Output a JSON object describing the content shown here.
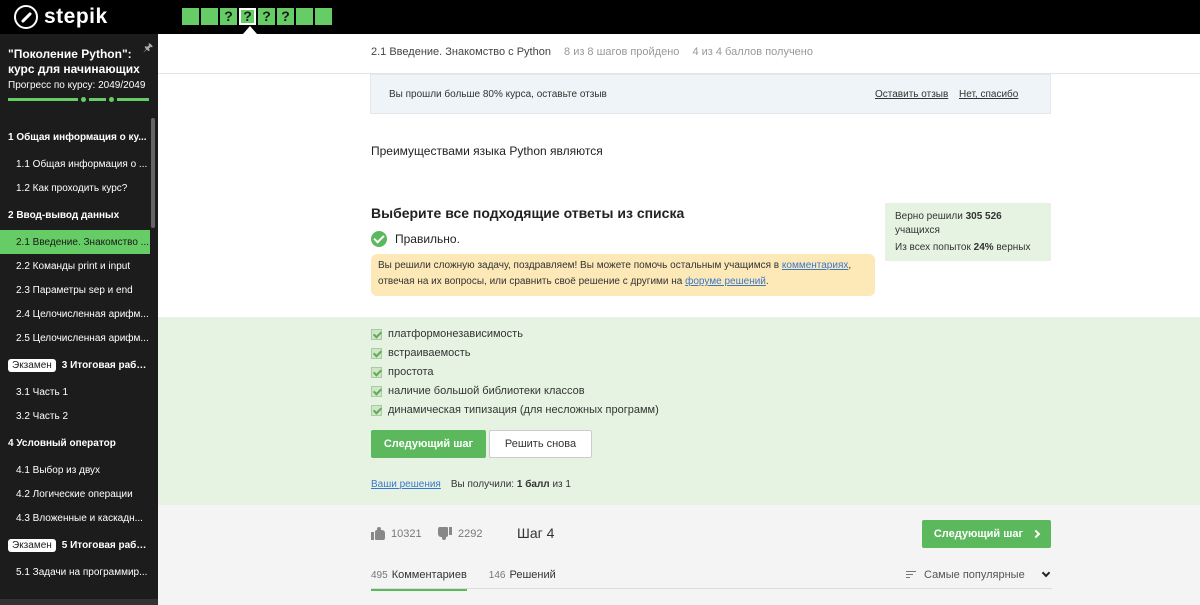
{
  "header": {
    "logo_text": "stepik",
    "step_buttons": [
      "",
      "",
      "?",
      "?",
      "?",
      "?",
      "",
      ""
    ],
    "active_step_index": 3
  },
  "sidebar": {
    "course_title": "\"Поколение Python\": курс для начинающих",
    "progress_label": "Прогресс по курсу:  2049/2049",
    "progress_fraction": 1.0,
    "toc": [
      {
        "kind": "module",
        "label": "1  Общая информация о ку..."
      },
      {
        "kind": "lesson",
        "label": "1.1  Общая информация о ..."
      },
      {
        "kind": "lesson",
        "label": "1.2  Как проходить курс?"
      },
      {
        "kind": "module",
        "label": "2  Ввод-вывод данных"
      },
      {
        "kind": "lesson",
        "label": "2.1  Введение. Знакомство ...",
        "active": true
      },
      {
        "kind": "lesson",
        "label": "2.2  Команды print и input"
      },
      {
        "kind": "lesson",
        "label": "2.3  Параметры sep и end"
      },
      {
        "kind": "lesson",
        "label": "2.4  Целочисленная арифм..."
      },
      {
        "kind": "lesson",
        "label": "2.5  Целочисленная арифм..."
      },
      {
        "kind": "module",
        "badge": "Экзамен",
        "label": "3  Итоговая работа..."
      },
      {
        "kind": "lesson",
        "label": "3.1  Часть 1"
      },
      {
        "kind": "lesson",
        "label": "3.2  Часть 2"
      },
      {
        "kind": "module",
        "label": "4  Условный оператор"
      },
      {
        "kind": "lesson",
        "label": "4.1  Выбор из двух"
      },
      {
        "kind": "lesson",
        "label": "4.2  Логические операции"
      },
      {
        "kind": "lesson",
        "label": "4.3  Вложенные и каскадн..."
      },
      {
        "kind": "module",
        "badge": "Экзамен",
        "label": "5  Итоговая работа..."
      },
      {
        "kind": "lesson",
        "label": "5.1  Задачи на программир..."
      }
    ]
  },
  "step_header": {
    "title": "2.1 Введение. Знакомство с Python",
    "steps_done": "8 из 8 шагов пройдено",
    "points": "4 из 4 баллов  получено"
  },
  "feedback_banner": {
    "text": "Вы прошли больше 80% курса, оставьте отзыв",
    "leave_review": "Оставить отзыв",
    "no_thanks": "Нет, спасибо"
  },
  "question": {
    "text": "Преимуществами языка Python являются",
    "choose_title": "Выберите все подходящие ответы из списка",
    "correct_label": "Правильно.",
    "congrats_before": "Вы решили сложную задачу, поздравляем! Вы можете помочь остальным учащимся в ",
    "congrats_link1": "комментариях",
    "congrats_middle": ", отвечая на их вопросы, или сравнить своё решение с другими на ",
    "congrats_link2": "форуме решений",
    "congrats_after": "."
  },
  "stats": {
    "solved_prefix": "Верно решили ",
    "solved_count": "305 526",
    "solved_suffix": "учащихся",
    "attempts_prefix": "Из всех попыток ",
    "attempts_percent": "24%",
    "attempts_suffix": " верных"
  },
  "answers": [
    "платформонезависимость",
    "встраиваемость",
    "простота",
    "наличие большой библиотеки классов",
    "динамическая типизация (для несложных программ)"
  ],
  "actions": {
    "next_step": "Следующий шаг",
    "retry": "Решить снова",
    "your_solutions": "Ваши решения",
    "result_prefix": "Вы получили: ",
    "result_score": "1 балл",
    "result_suffix": " из 1"
  },
  "footer": {
    "likes": "10321",
    "dislikes": "2292",
    "step_label": "Шаг 4",
    "next_step": "Следующий шаг",
    "tabs": [
      {
        "count": "495",
        "label": "Комментариев",
        "active": true
      },
      {
        "count": "146",
        "label": "Решений",
        "active": false
      }
    ],
    "sort_label": "Самые популярные"
  },
  "colors": {
    "accent_green": "#5cb85c",
    "step_green": "#66cc66",
    "answers_bg": "#e6f3e2",
    "congrats_bg": "#fde9b8",
    "link_blue": "#3a77c9"
  }
}
